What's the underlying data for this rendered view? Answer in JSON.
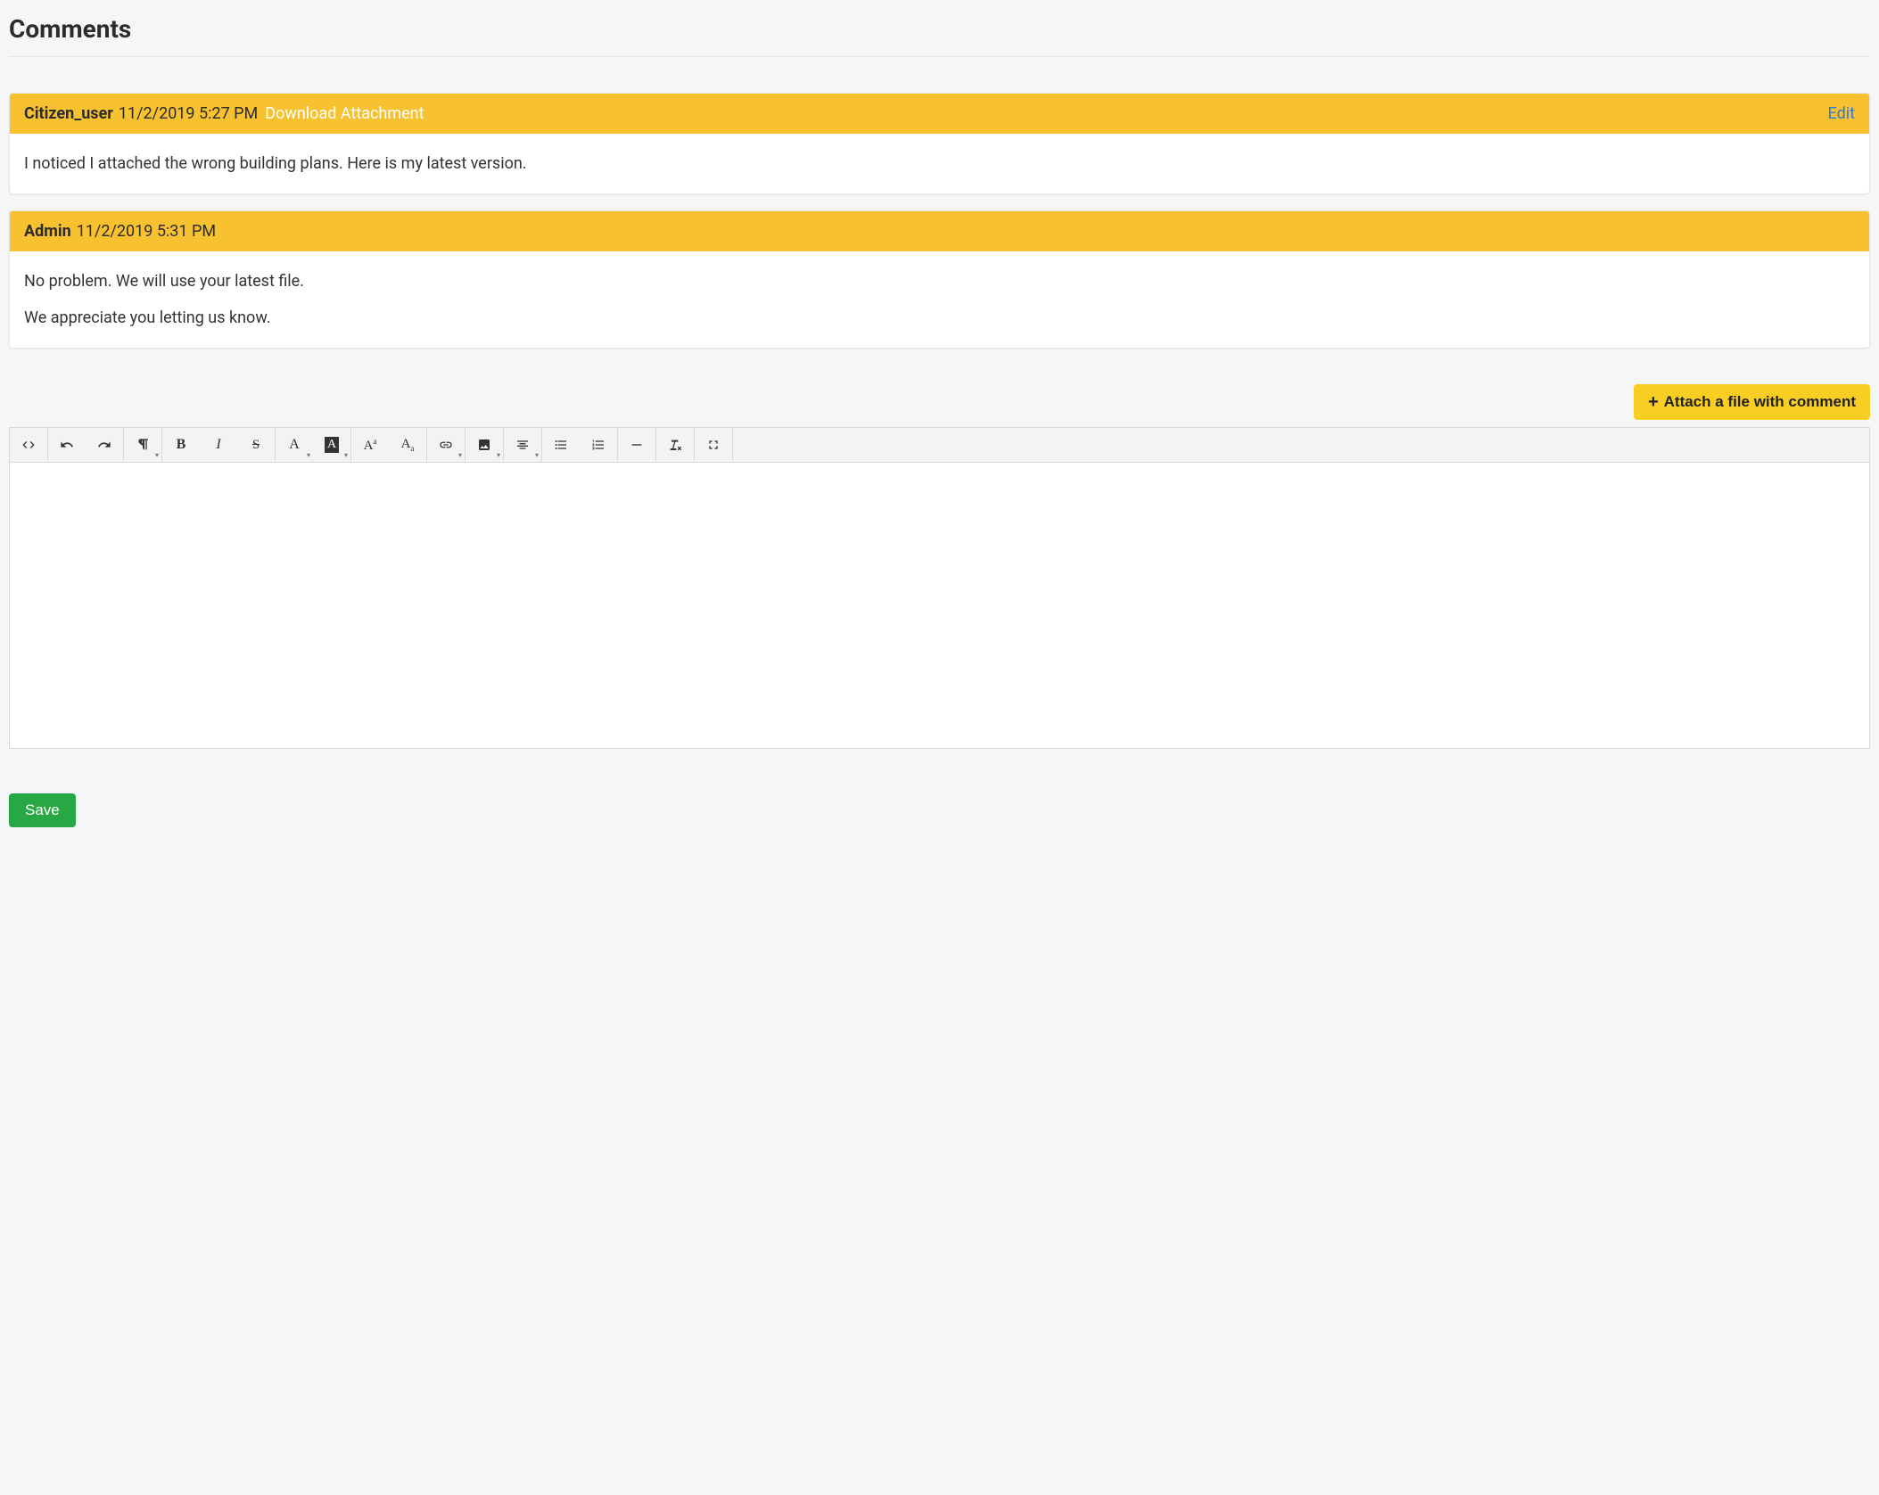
{
  "page": {
    "title": "Comments"
  },
  "comments": [
    {
      "author": "Citizen_user",
      "date": "11/2/2019 5:27 PM",
      "download_label": "Download Attachment",
      "edit_label": "Edit",
      "has_attachment": true,
      "editable": true,
      "body_paragraphs": [
        "I noticed I attached the wrong building plans. Here is my latest version."
      ]
    },
    {
      "author": "Admin",
      "date": "11/2/2019 5:31 PM",
      "has_attachment": false,
      "editable": false,
      "body_paragraphs": [
        "No problem. We will use your latest file.",
        "We appreciate you letting us know."
      ]
    }
  ],
  "attach_button": {
    "label": "Attach a file with comment"
  },
  "toolbar": {
    "code_view": "Code View",
    "undo": "Undo",
    "redo": "Redo",
    "paragraph_format": "Paragraph Format",
    "bold": "B",
    "italic": "I",
    "strike": "S",
    "text_color": "A",
    "back_color": "A",
    "superscript_base": "A",
    "subscript_base": "A",
    "link": "Insert Link",
    "image": "Insert Image",
    "align": "Align",
    "ul": "Unordered List",
    "ol": "Ordered List",
    "hr": "Horizontal Line",
    "clear": "Clear Formatting",
    "fullscreen": "Fullscreen"
  },
  "save_button": {
    "label": "Save"
  }
}
